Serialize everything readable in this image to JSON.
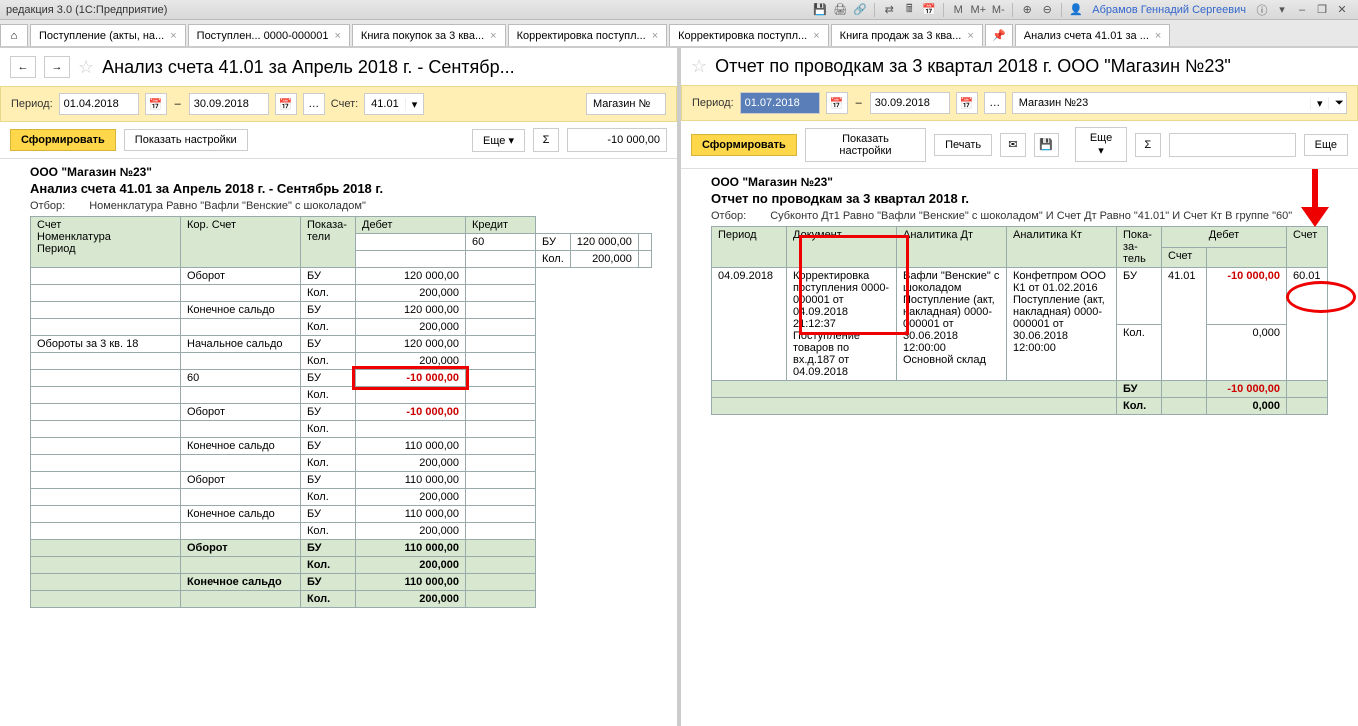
{
  "app_title": "редакция 3.0   (1С:Предприятие)",
  "user": "Абрамов Геннадий Сергеевич",
  "toolbar_letters": {
    "m": "M",
    "mp": "M+",
    "mm": "M-"
  },
  "tabs": [
    {
      "label": "Поступление (акты, на..."
    },
    {
      "label": "Поступлен... 0000-000001"
    },
    {
      "label": "Книга покупок за 3 ква..."
    },
    {
      "label": "Корректировка поступл..."
    },
    {
      "label": "Корректировка поступл..."
    },
    {
      "label": "Книга продаж за 3 ква..."
    },
    {
      "label": "Анализ счета 41.01 за ..."
    }
  ],
  "left": {
    "title": "Анализ счета 41.01 за Апрель 2018 г. - Сентябр...",
    "period_label": "Период:",
    "from": "01.04.2018",
    "to": "30.09.2018",
    "account_label": "Счет:",
    "account": "41.01",
    "org": "Магазин №",
    "form_btn": "Сформировать",
    "show_settings": "Показать настройки",
    "more": "Еще",
    "amount": "-10 000,00",
    "report": {
      "org": "ООО \"Магазин №23\"",
      "title": "Анализ счета 41.01 за Апрель 2018 г. - Сентябрь 2018 г.",
      "filter_k": "Отбор:",
      "filter_v": "Номенклатура Равно \"Вафли \"Венские\" с шоколадом\"",
      "head": {
        "c1": "Счет",
        "c1b": "Номенклатура",
        "c1c": "Период",
        "c2": "Кор. Счет",
        "c3": "Показа-\nтели",
        "c4": "Дебет",
        "c5": "Кредит"
      },
      "rows": [
        {
          "a": "",
          "b": "60",
          "c": "БУ",
          "d": "120 000,00"
        },
        {
          "a": "",
          "b": "",
          "c": "Кол.",
          "d": "200,000"
        },
        {
          "a": "",
          "b": "Оборот",
          "c": "БУ",
          "d": "120 000,00"
        },
        {
          "a": "",
          "b": "",
          "c": "Кол.",
          "d": "200,000"
        },
        {
          "a": "",
          "b": "Конечное сальдо",
          "c": "БУ",
          "d": "120 000,00"
        },
        {
          "a": "",
          "b": "",
          "c": "Кол.",
          "d": "200,000"
        },
        {
          "a": "Обороты за 3 кв. 18",
          "b": "Начальное сальдо",
          "c": "БУ",
          "d": "120 000,00"
        },
        {
          "a": "",
          "b": "",
          "c": "Кол.",
          "d": "200,000"
        },
        {
          "a": "",
          "b": "60",
          "c": "БУ",
          "d": "-10 000,00",
          "neg": true,
          "hl": true
        },
        {
          "a": "",
          "b": "",
          "c": "Кол.",
          "d": ""
        },
        {
          "a": "",
          "b": "Оборот",
          "c": "БУ",
          "d": "-10 000,00",
          "neg": true
        },
        {
          "a": "",
          "b": "",
          "c": "Кол.",
          "d": ""
        },
        {
          "a": "",
          "b": "Конечное сальдо",
          "c": "БУ",
          "d": "110 000,00"
        },
        {
          "a": "",
          "b": "",
          "c": "Кол.",
          "d": "200,000"
        },
        {
          "a": "",
          "b": "Оборот",
          "c": "БУ",
          "d": "110 000,00"
        },
        {
          "a": "",
          "b": "",
          "c": "Кол.",
          "d": "200,000"
        },
        {
          "a": "",
          "b": "Конечное сальдо",
          "c": "БУ",
          "d": "110 000,00"
        },
        {
          "a": "",
          "b": "",
          "c": "Кол.",
          "d": "200,000"
        }
      ],
      "totals": [
        {
          "a": "",
          "b": "Оборот",
          "c": "БУ",
          "d": "110 000,00"
        },
        {
          "a": "",
          "b": "",
          "c": "Кол.",
          "d": "200,000"
        },
        {
          "a": "",
          "b": "Конечное сальдо",
          "c": "БУ",
          "d": "110 000,00"
        },
        {
          "a": "",
          "b": "",
          "c": "Кол.",
          "d": "200,000"
        }
      ]
    }
  },
  "right": {
    "title": "Отчет по проводкам за 3 квартал 2018 г. ООО \"Магазин №23\"",
    "period_label": "Период:",
    "from": "01.07.2018",
    "to": "30.09.2018",
    "org": "Магазин №23",
    "form_btn": "Сформировать",
    "show_settings": "Показать настройки",
    "print": "Печать",
    "more": "Еще",
    "more2": "Еще",
    "report": {
      "org": "ООО \"Магазин №23\"",
      "title": "Отчет по проводкам за 3 квартал 2018 г.",
      "filter_k": "Отбор:",
      "filter_v": "Субконто Дт1 Равно \"Вафли \"Венские\" с шоколадом\" И Счет Дт Равно \"41.01\" И Счет Кт В группе \"60\"",
      "head": {
        "c1": "Период",
        "c2": "Документ",
        "c3": "Аналитика Дт",
        "c4": "Аналитика Кт",
        "c5": "Пока-за-\nтель",
        "c6": "Дебет",
        "c6a": "Счет",
        "c7": "Счет"
      },
      "row": {
        "period": "04.09.2018",
        "doc": "Корректировка поступления 0000-000001 от 04.09.2018 21:12:37 Поступление товаров по вх.д.187 от 04.09.2018",
        "adt": "Вафли \"Венские\" с шоколадом\nПоступление (акт, накладная) 0000-000001 от 30.06.2018 12:00:00\nОсновной склад",
        "akt": "Конфетпром ООО К1 от 01.02.2016 Поступление (акт, накладная) 0000-000001 от 30.06.2018 12:00:00",
        "p1": "БУ",
        "p2": "Кол.",
        "acct": "41.01",
        "v1": "-10 000,00",
        "v2": "0,000",
        "acct2": "60.01"
      },
      "totals": {
        "p1": "БУ",
        "p2": "Кол.",
        "v1": "-10 000,00",
        "v2": "0,000"
      }
    }
  }
}
